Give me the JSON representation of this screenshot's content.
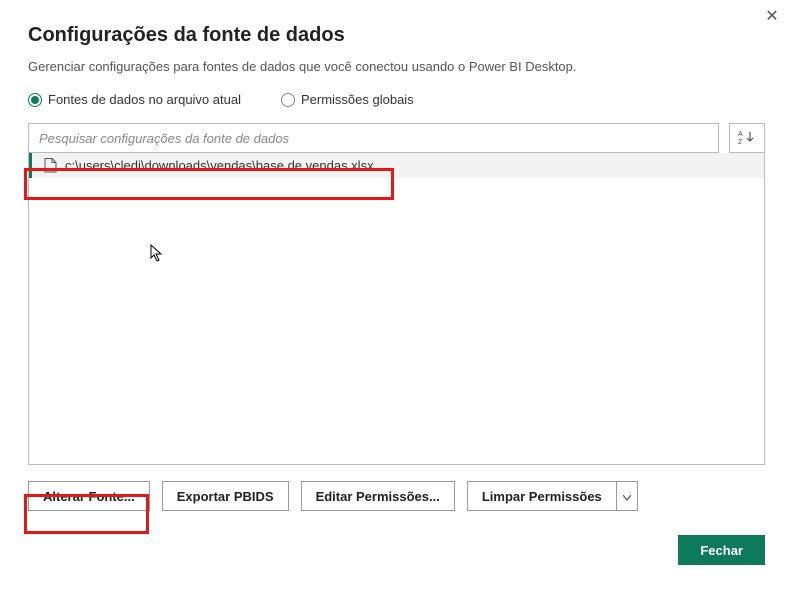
{
  "dialog": {
    "title": "Configurações da fonte de dados",
    "subtitle": "Gerenciar configurações para fontes de dados que você conectou usando o Power BI Desktop."
  },
  "radios": {
    "current": "Fontes de dados no arquivo atual",
    "global": "Permissões globais",
    "selected": "current"
  },
  "search": {
    "placeholder": "Pesquisar configurações da fonte de dados"
  },
  "sources": [
    {
      "path": "c:\\users\\cledi\\downloads\\vendas\\base de vendas.xlsx"
    }
  ],
  "buttons": {
    "change_source": "Alterar Fonte...",
    "export_pbids": "Exportar PBIDS",
    "edit_permissions": "Editar Permissões...",
    "clear_permissions": "Limpar Permissões",
    "close": "Fechar"
  }
}
